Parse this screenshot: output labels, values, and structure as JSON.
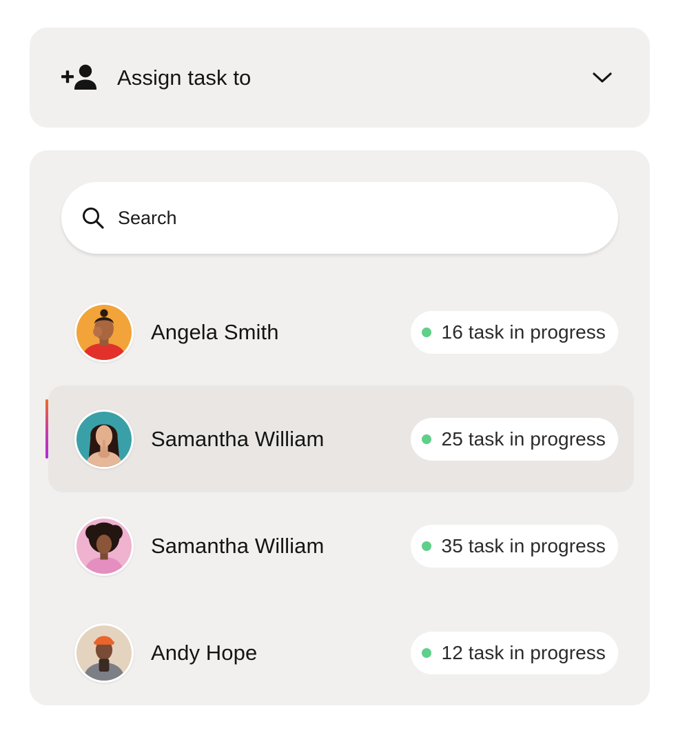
{
  "assign": {
    "label": "Assign task to",
    "icon": "add-person-icon",
    "toggle_icon": "chevron-down-icon"
  },
  "search": {
    "placeholder": "Search",
    "icon": "search-icon"
  },
  "colors": {
    "status_dot": "#5fcf8a",
    "selected_accent_start": "#ef6a2a",
    "selected_accent_end": "#b42bd9",
    "panel_bg": "#f1f0ef"
  },
  "people": [
    {
      "name": "Angela Smith",
      "status": "16 task in progress",
      "selected": false
    },
    {
      "name": "Samantha William",
      "status": "25 task in progress",
      "selected": true
    },
    {
      "name": "Samantha William",
      "status": "35 task in progress",
      "selected": false
    },
    {
      "name": "Andy Hope",
      "status": "12 task in progress",
      "selected": false
    }
  ]
}
